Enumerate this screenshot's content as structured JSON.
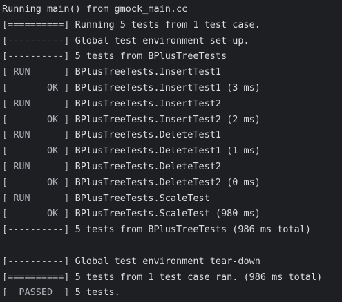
{
  "terminal": {
    "lines": [
      {
        "prefix": "",
        "text": "Running main() from gmock_main.cc"
      },
      {
        "prefix": "[==========]",
        "text": " Running 5 tests from 1 test case."
      },
      {
        "prefix": "[----------]",
        "text": " Global test environment set-up."
      },
      {
        "prefix": "[----------]",
        "text": " 5 tests from BPlusTreeTests"
      },
      {
        "prefix": "[ RUN      ]",
        "text": " BPlusTreeTests.InsertTest1"
      },
      {
        "prefix": "[       OK ]",
        "text": " BPlusTreeTests.InsertTest1 (3 ms)"
      },
      {
        "prefix": "[ RUN      ]",
        "text": " BPlusTreeTests.InsertTest2"
      },
      {
        "prefix": "[       OK ]",
        "text": " BPlusTreeTests.InsertTest2 (2 ms)"
      },
      {
        "prefix": "[ RUN      ]",
        "text": " BPlusTreeTests.DeleteTest1"
      },
      {
        "prefix": "[       OK ]",
        "text": " BPlusTreeTests.DeleteTest1 (1 ms)"
      },
      {
        "prefix": "[ RUN      ]",
        "text": " BPlusTreeTests.DeleteTest2"
      },
      {
        "prefix": "[       OK ]",
        "text": " BPlusTreeTests.DeleteTest2 (0 ms)"
      },
      {
        "prefix": "[ RUN      ]",
        "text": " BPlusTreeTests.ScaleTest"
      },
      {
        "prefix": "[       OK ]",
        "text": " BPlusTreeTests.ScaleTest (980 ms)"
      },
      {
        "prefix": "[----------]",
        "text": " 5 tests from BPlusTreeTests (986 ms total)"
      },
      {
        "prefix": "",
        "text": ""
      },
      {
        "prefix": "[----------]",
        "text": " Global test environment tear-down"
      },
      {
        "prefix": "[==========]",
        "text": " 5 tests from 1 test case ran. (986 ms total)"
      },
      {
        "prefix": "[  PASSED  ]",
        "text": " 5 tests."
      }
    ]
  },
  "colors": {
    "background": "#1e1f22",
    "text": "#dcdcdc",
    "status_prefix": "#aeb3ba"
  }
}
